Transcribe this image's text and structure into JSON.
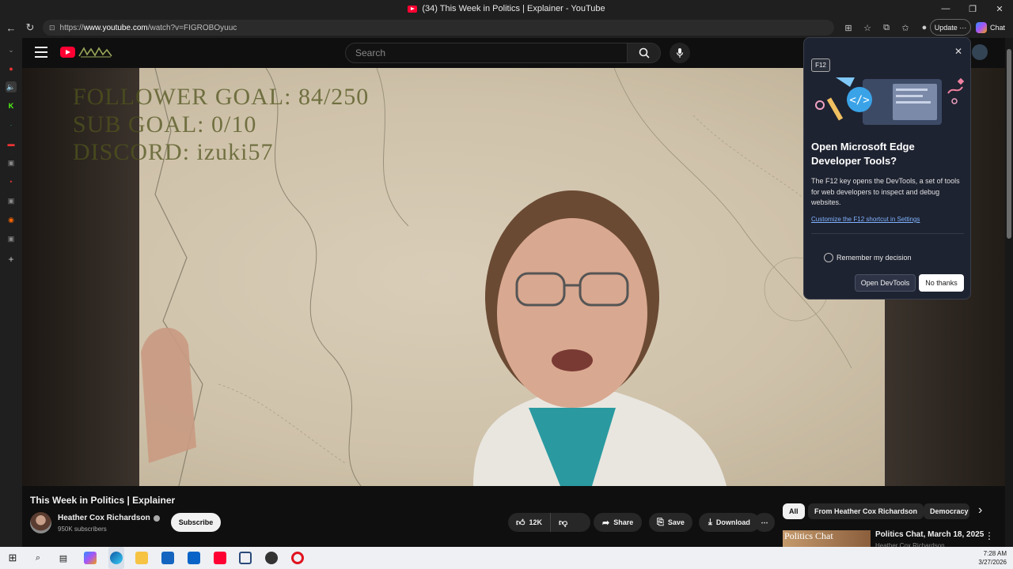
{
  "window": {
    "title": "(34) This Week in Politics | Explainer - YouTube",
    "controls": {
      "minimize": "—",
      "restore": "❐",
      "close": "✕"
    }
  },
  "browser": {
    "url_prefix": "https://",
    "url_domain": "www.youtube.com",
    "url_path": "/watch?v=FIGROBOyuuc",
    "update_label": "Update",
    "update_more": "···",
    "chat_label": "Chat"
  },
  "youtube": {
    "search_placeholder": "Search"
  },
  "video": {
    "overlay": {
      "follower_goal": "FOLLOWER GOAL:  84/250",
      "sub_goal": "SUB GOAL: 0/10",
      "discord": "DISCORD: izuki57"
    },
    "title": "This Week in Politics | Explainer",
    "channel_name": "Heather Cox Richardson",
    "subscribers": "950K subscribers",
    "subscribe_label": "Subscribe",
    "likes": "12K",
    "share_label": "Share",
    "save_label": "Save",
    "download_label": "Download",
    "more_label": "⋯"
  },
  "recommendations": {
    "chips": [
      "All",
      "From Heather Cox Richardson",
      "Democracy"
    ],
    "next_arrow": "›",
    "first_item": {
      "thumb_text": "Politics Chat",
      "title": "Politics Chat, March 18, 2025",
      "channel": "Heather Cox Richardson"
    }
  },
  "devtools_popup": {
    "chip": "F12",
    "title": "Open Microsoft Edge Developer Tools?",
    "body": "The F12 key opens the DevTools, a set of tools for web developers to inspect and debug websites.",
    "link": "Customize the F12 shortcut in Settings",
    "checkbox_label": "Remember my decision",
    "open_label": "Open DevTools",
    "decline_label": "No thanks",
    "close_icon": "✕"
  },
  "taskbar": {
    "time": "7:28 AM",
    "date": "3/27/2026"
  },
  "colors": {
    "youtube_red": "#ff0033",
    "popup_bg": "#1e2331",
    "link_blue": "#7fb2ff"
  }
}
